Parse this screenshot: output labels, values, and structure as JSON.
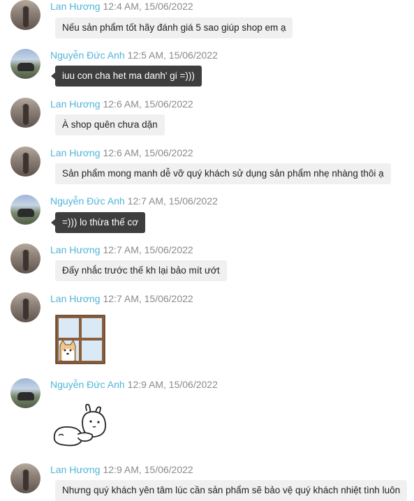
{
  "messages": [
    {
      "sender": "Lan Hương",
      "time": "12:4 AM, 15/06/2022",
      "text": "Nếu sản phẩm tốt hãy đánh giá 5 sao giúp shop em ạ",
      "style": "light"
    },
    {
      "sender": "Nguyễn Đức Anh",
      "time": "12:5 AM, 15/06/2022",
      "text": "iuu con cha het ma danh' gi =)))",
      "style": "dark"
    },
    {
      "sender": "Lan Hương",
      "time": "12:6 AM, 15/06/2022",
      "text": "À shop quên chưa dặn",
      "style": "light"
    },
    {
      "sender": "Lan Hương",
      "time": "12:6 AM, 15/06/2022",
      "text": "Sản phẩm mong manh dễ vỡ quý khách sử dụng sản phẩm nhẹ nhàng thôi ạ",
      "style": "light"
    },
    {
      "sender": "Nguyễn Đức Anh",
      "time": "12:7 AM, 15/06/2022",
      "text": "=))) lo thừa thế cơ",
      "style": "dark"
    },
    {
      "sender": "Lan Hương",
      "time": "12:7 AM, 15/06/2022",
      "text": "Đấy nhắc trước thế kh lại bảo mít ướt",
      "style": "light"
    },
    {
      "sender": "Lan Hương",
      "time": "12:7 AM, 15/06/2022",
      "sticker": "dog-window-sticker"
    },
    {
      "sender": "Nguyễn Đức Anh",
      "time": "12:9 AM, 15/06/2022",
      "sticker": "rabbit-sticker"
    },
    {
      "sender": "Lan Hương",
      "time": "12:9 AM, 15/06/2022",
      "text": "Nhưng quý khách yên tâm lúc cần sản phẩm sẽ bảo vệ quý khách nhiệt tình luôn",
      "style": "light"
    }
  ],
  "colors": {
    "sender_name": "#4fb5d8",
    "timestamp": "#8a8a8a",
    "bubble_light": "#f0f0f0",
    "bubble_dark": "#3e3e3e"
  }
}
